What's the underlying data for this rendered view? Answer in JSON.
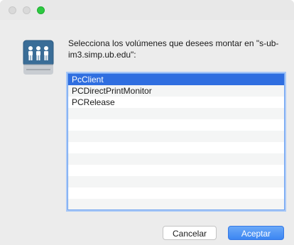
{
  "dialog": {
    "message": "Selecciona los volúmenes que desees montar en \"s-ub-im3.simp.ub.edu\":",
    "icon": "shared-server-drive-icon",
    "accent_color": "#2f6ee0"
  },
  "volumes": {
    "items": [
      {
        "label": "PcClient",
        "selected": true
      },
      {
        "label": "PCDirectPrintMonitor",
        "selected": false
      },
      {
        "label": "PCRelease",
        "selected": false
      }
    ],
    "empty_rows": 8
  },
  "buttons": {
    "cancel_label": "Cancelar",
    "ok_label": "Aceptar"
  }
}
